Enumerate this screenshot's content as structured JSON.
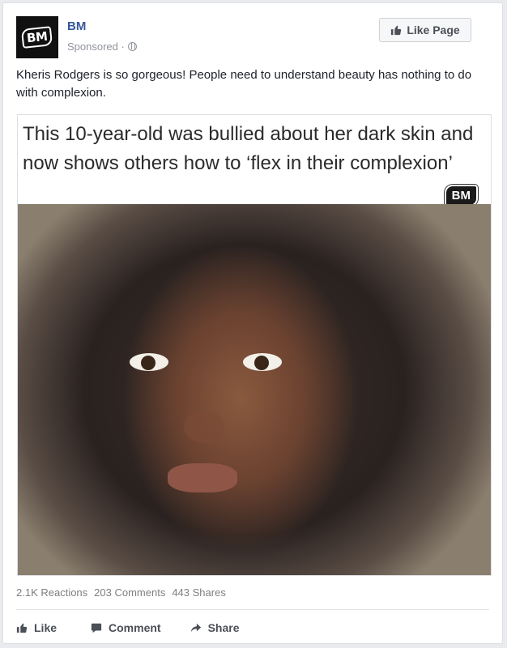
{
  "post": {
    "page_name": "BM",
    "avatar_text": "BM",
    "sponsored": "Sponsored ·",
    "like_page_label": "Like Page",
    "text": "Kheris Rodgers is so gorgeous! People need to understand beauty has nothing to do with complexion."
  },
  "media": {
    "headline": "This 10-year-old was bullied about her dark skin and now shows others how to ‘flex in their complexion’",
    "watermark": "BM"
  },
  "stats": {
    "reactions": "2.1K Reactions",
    "comments": "203 Comments",
    "shares": "443 Shares"
  },
  "actions": {
    "like": "Like",
    "comment": "Comment",
    "share": "Share"
  },
  "colors": {
    "link": "#365899",
    "text": "#1d2129",
    "muted": "#90949c"
  }
}
